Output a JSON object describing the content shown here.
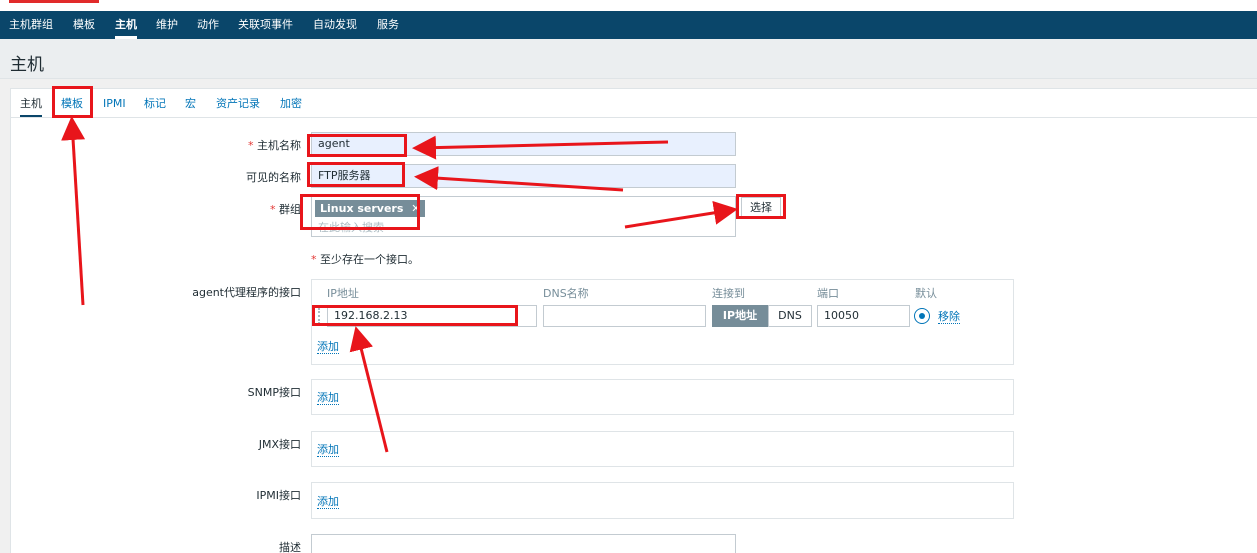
{
  "nav": {
    "items": [
      "主机群组",
      "模板",
      "主机",
      "维护",
      "动作",
      "关联项事件",
      "自动发现",
      "服务"
    ],
    "active": "主机"
  },
  "page": {
    "title": "主机"
  },
  "tabs": [
    "主机",
    "模板",
    "IPMI",
    "标记",
    "宏",
    "资产记录",
    "加密"
  ],
  "form": {
    "required_mark": "*",
    "host_name_label": "主机名称",
    "host_name_value": "agent",
    "visible_name_label": "可见的名称",
    "visible_name_value": "FTP服务器",
    "groups_label": "群组",
    "group_tag": "Linux servers",
    "group_tag_remove": "✕",
    "groups_placeholder": "在此输入搜索",
    "select_button": "选择",
    "interface_note": "至少存在一个接口。",
    "agent_label": "agent代理程序的接口",
    "columns": {
      "ip": "IP地址",
      "dns": "DNS名称",
      "connect": "连接到",
      "port": "端口",
      "default": "默认"
    },
    "agent_ip": "192.168.2.13",
    "agent_dns": "",
    "connect_ip": "IP地址",
    "connect_dns": "DNS",
    "agent_port": "10050",
    "remove_link": "移除",
    "add_link": "添加",
    "snmp_label": "SNMP接口",
    "jmx_label": "JMX接口",
    "ipmi_label": "IPMI接口",
    "description_label": "描述"
  },
  "colors": {
    "nav_bg": "#0a466a",
    "link": "#0275b8",
    "annotation": "#e8151b",
    "button_active": "#768d99"
  }
}
